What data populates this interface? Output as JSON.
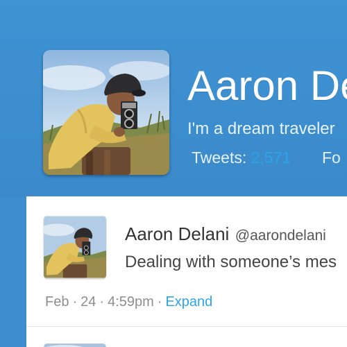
{
  "profile": {
    "name": "Aaron De",
    "bio": "I'm a dream traveler",
    "stats": {
      "tweets_label": "Tweets:",
      "tweets_value": "2,571",
      "next_label": "Fo"
    }
  },
  "tweet": {
    "author": "Aaron Delani",
    "handle": "@aarondelani",
    "text": "Dealing with someone’s mes",
    "date_month": "Feb",
    "date_day": "24",
    "time": "4:59pm",
    "separator": "·",
    "expand_label": "Expand"
  },
  "colors": {
    "header_bg": "#3d8ecf",
    "accent": "#2aa5e8",
    "card_bg": "#ffffff"
  },
  "icons": {
    "avatar": "photographer-photo"
  }
}
